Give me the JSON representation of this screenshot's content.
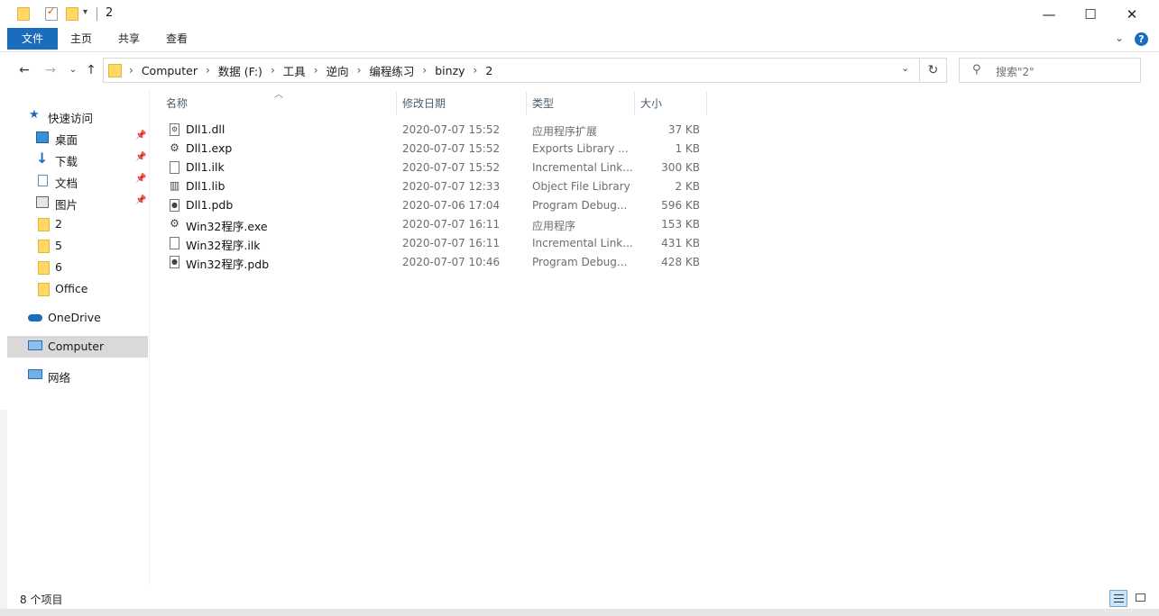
{
  "window": {
    "title": "2",
    "minimize_glyph": "—",
    "maximize_glyph": "☐",
    "close_glyph": "✕"
  },
  "ribbon": {
    "tabs": [
      "文件",
      "主页",
      "共享",
      "查看"
    ],
    "collapse_glyph": "⌄",
    "help_glyph": "?"
  },
  "nav": {
    "back_glyph": "←",
    "forward_glyph": "→",
    "recent_glyph": "⌄",
    "up_glyph": "↑",
    "refresh_glyph": "↻",
    "breadcrumbs": [
      "Computer",
      "数据 (F:)",
      "工具",
      "逆向",
      "编程练习",
      "binzy",
      "2"
    ],
    "search_placeholder": "搜索\"2\""
  },
  "sidebar": {
    "quick_access": "快速访问",
    "items": [
      {
        "label": "桌面",
        "icon": "desktop-icon",
        "pinned": true
      },
      {
        "label": "下载",
        "icon": "download-icon",
        "pinned": true
      },
      {
        "label": "文档",
        "icon": "document-icon",
        "pinned": true
      },
      {
        "label": "图片",
        "icon": "picture-icon",
        "pinned": true
      },
      {
        "label": "2",
        "icon": "folder-icon",
        "pinned": false
      },
      {
        "label": "5",
        "icon": "folder-icon",
        "pinned": false
      },
      {
        "label": "6",
        "icon": "folder-icon",
        "pinned": false
      },
      {
        "label": "Office",
        "icon": "folder-icon",
        "pinned": false
      }
    ],
    "onedrive": "OneDrive",
    "computer": "Computer",
    "network": "网络"
  },
  "columns": {
    "name": "名称",
    "date": "修改日期",
    "type": "类型",
    "size": "大小"
  },
  "files": [
    {
      "name": "Dll1.dll",
      "date": "2020-07-07 15:52",
      "type": "应用程序扩展",
      "size": "37 KB",
      "icon": "dll-file-icon"
    },
    {
      "name": "Dll1.exp",
      "date": "2020-07-07 15:52",
      "type": "Exports Library ...",
      "size": "1 KB",
      "icon": "exp-file-icon"
    },
    {
      "name": "Dll1.ilk",
      "date": "2020-07-07 15:52",
      "type": "Incremental Link...",
      "size": "300 KB",
      "icon": "ilk-file-icon"
    },
    {
      "name": "Dll1.lib",
      "date": "2020-07-07 12:33",
      "type": "Object File Library",
      "size": "2 KB",
      "icon": "lib-file-icon"
    },
    {
      "name": "Dll1.pdb",
      "date": "2020-07-06 17:04",
      "type": "Program Debug...",
      "size": "596 KB",
      "icon": "pdb-file-icon"
    },
    {
      "name": "Win32程序.exe",
      "date": "2020-07-07 16:11",
      "type": "应用程序",
      "size": "153 KB",
      "icon": "exe-file-icon"
    },
    {
      "name": "Win32程序.ilk",
      "date": "2020-07-07 16:11",
      "type": "Incremental Link...",
      "size": "431 KB",
      "icon": "ilk-file-icon"
    },
    {
      "name": "Win32程序.pdb",
      "date": "2020-07-07 10:46",
      "type": "Program Debug...",
      "size": "428 KB",
      "icon": "pdb-file-icon"
    }
  ],
  "status": {
    "item_count": "8 个项目"
  },
  "colors": {
    "accent": "#1a6dbd",
    "folder": "#ffd866",
    "selection": "#d9d9d9"
  }
}
